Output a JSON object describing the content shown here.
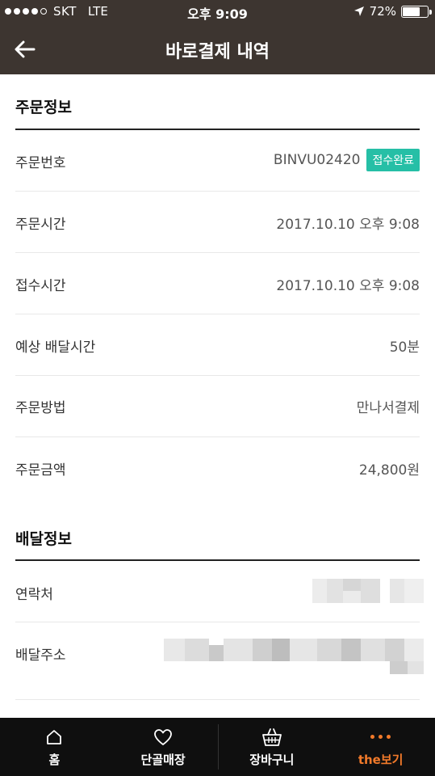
{
  "status_bar": {
    "carrier": "SKT",
    "network": "LTE",
    "time": "오후 9:09",
    "battery": "72%",
    "battery_level": 0.72
  },
  "header": {
    "title": "바로결제 내역"
  },
  "order_info": {
    "title": "주문정보",
    "rows": [
      {
        "label": "주문번호",
        "value": "BINVU02420",
        "badge": "접수완료"
      },
      {
        "label": "주문시간",
        "value": "2017.10.10 오후 9:08"
      },
      {
        "label": "접수시간",
        "value": "2017.10.10 오후 9:08"
      },
      {
        "label": "예상 배달시간",
        "value": "50분"
      },
      {
        "label": "주문방법",
        "value": "만나서결제"
      },
      {
        "label": "주문금액",
        "value": "24,800원"
      }
    ]
  },
  "delivery_info": {
    "title": "배달정보",
    "rows": [
      {
        "label": "연락처"
      },
      {
        "label": "배달주소"
      }
    ]
  },
  "tabs": [
    {
      "label": "홈",
      "icon": "home-icon"
    },
    {
      "label": "단골매장",
      "icon": "heart-icon"
    },
    {
      "label": "장바구니",
      "icon": "basket-icon"
    },
    {
      "label": "the보기",
      "icon": "more-dots-icon"
    }
  ],
  "colors": {
    "header_bg": "#3d3530",
    "accent_teal": "#26bfa6",
    "active_tab": "#f27a2a",
    "tabbar_bg": "#0f0f0f"
  }
}
